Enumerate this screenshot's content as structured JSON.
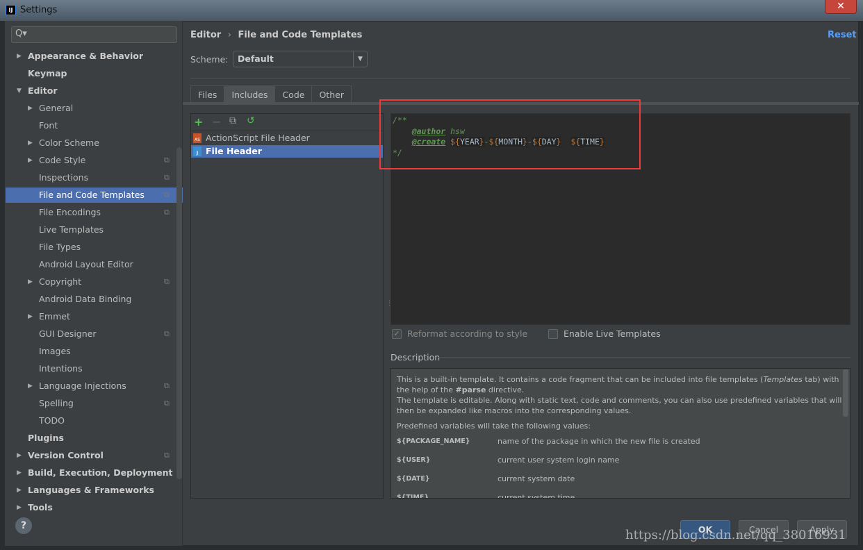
{
  "window": {
    "title": "Settings",
    "app_icon": "IJ",
    "close": "✕"
  },
  "search": {
    "icon": "Q▾",
    "placeholder": ""
  },
  "sidebar": {
    "items": [
      {
        "label": "Appearance & Behavior",
        "level": 0,
        "bold": true,
        "arrow": "▶"
      },
      {
        "label": "Keymap",
        "level": 0,
        "bold": true
      },
      {
        "label": "Editor",
        "level": 0,
        "bold": true,
        "arrow": "▼"
      },
      {
        "label": "General",
        "level": 1,
        "arrow": "▶"
      },
      {
        "label": "Font",
        "level": 1
      },
      {
        "label": "Color Scheme",
        "level": 1,
        "arrow": "▶"
      },
      {
        "label": "Code Style",
        "level": 1,
        "arrow": "▶",
        "copy": true
      },
      {
        "label": "Inspections",
        "level": 1,
        "copy": true
      },
      {
        "label": "File and Code Templates",
        "level": 1,
        "copy": true,
        "selected": true
      },
      {
        "label": "File Encodings",
        "level": 1,
        "copy": true
      },
      {
        "label": "Live Templates",
        "level": 1
      },
      {
        "label": "File Types",
        "level": 1
      },
      {
        "label": "Android Layout Editor",
        "level": 1
      },
      {
        "label": "Copyright",
        "level": 1,
        "arrow": "▶",
        "copy": true
      },
      {
        "label": "Android Data Binding",
        "level": 1
      },
      {
        "label": "Emmet",
        "level": 1,
        "arrow": "▶"
      },
      {
        "label": "GUI Designer",
        "level": 1,
        "copy": true
      },
      {
        "label": "Images",
        "level": 1
      },
      {
        "label": "Intentions",
        "level": 1
      },
      {
        "label": "Language Injections",
        "level": 1,
        "arrow": "▶",
        "copy": true
      },
      {
        "label": "Spelling",
        "level": 1,
        "copy": true
      },
      {
        "label": "TODO",
        "level": 1
      },
      {
        "label": "Plugins",
        "level": 0,
        "bold": true
      },
      {
        "label": "Version Control",
        "level": 0,
        "bold": true,
        "arrow": "▶",
        "copy": true
      },
      {
        "label": "Build, Execution, Deployment",
        "level": 0,
        "bold": true,
        "arrow": "▶"
      },
      {
        "label": "Languages & Frameworks",
        "level": 0,
        "bold": true,
        "arrow": "▶"
      },
      {
        "label": "Tools",
        "level": 0,
        "bold": true,
        "arrow": "▶"
      }
    ]
  },
  "header": {
    "breadcrumb_parent": "Editor",
    "breadcrumb_sep": "›",
    "breadcrumb_current": "File and Code Templates",
    "reset": "Reset"
  },
  "scheme": {
    "label": "Scheme:",
    "value": "Default"
  },
  "tabs": [
    {
      "label": "Files"
    },
    {
      "label": "Includes",
      "active": true
    },
    {
      "label": "Code"
    },
    {
      "label": "Other"
    }
  ],
  "list_toolbar": {
    "add": "+",
    "remove": "−",
    "copy": "⧉",
    "reset": "↺"
  },
  "templates": [
    {
      "label": "ActionScript File Header",
      "badge": "AS"
    },
    {
      "label": "File Header",
      "badge": "J",
      "selected": true
    }
  ],
  "editor": {
    "l1": "/**",
    "author_tag": "@author",
    "author_val": " hsw",
    "create_tag": "@create",
    "v_year": "YEAR",
    "v_month": "MONTH",
    "v_day": "DAY",
    "v_time": "TIME",
    "l4": "*/"
  },
  "options": {
    "reformat": {
      "label": "Reformat according to style",
      "checked": true,
      "disabled": true
    },
    "live": {
      "label": "Enable Live Templates",
      "checked": false
    }
  },
  "description": {
    "title": "Description",
    "p1a": "This is a built-in template. It contains a code fragment that can be included into file templates (",
    "p1i": "Templates",
    "p1b": " tab) with the help of the ",
    "p1c": "#parse",
    "p1d": " directive.",
    "p2": "The template is editable. Along with static text, code and comments, you can also use predefined variables that will then be expanded like macros into the corresponding values.",
    "p3": "Predefined variables will take the following values:",
    "vars": [
      {
        "k": "${PACKAGE_NAME}",
        "v": "name of the package in which the new file is created"
      },
      {
        "k": "${USER}",
        "v": "current user system login name"
      },
      {
        "k": "${DATE}",
        "v": "current system date"
      },
      {
        "k": "${TIME}",
        "v": "current system time"
      }
    ]
  },
  "buttons": {
    "ok": "OK",
    "cancel": "Cancel",
    "apply": "Apply",
    "help": "?"
  },
  "watermark": "https://blog.csdn.net/qq_38016931",
  "colors": {
    "accent": "#4b6eaf",
    "panel": "#3c3f41",
    "editor": "#2b2b2b",
    "highlight_box": "#f03a3a",
    "link": "#589df6"
  }
}
